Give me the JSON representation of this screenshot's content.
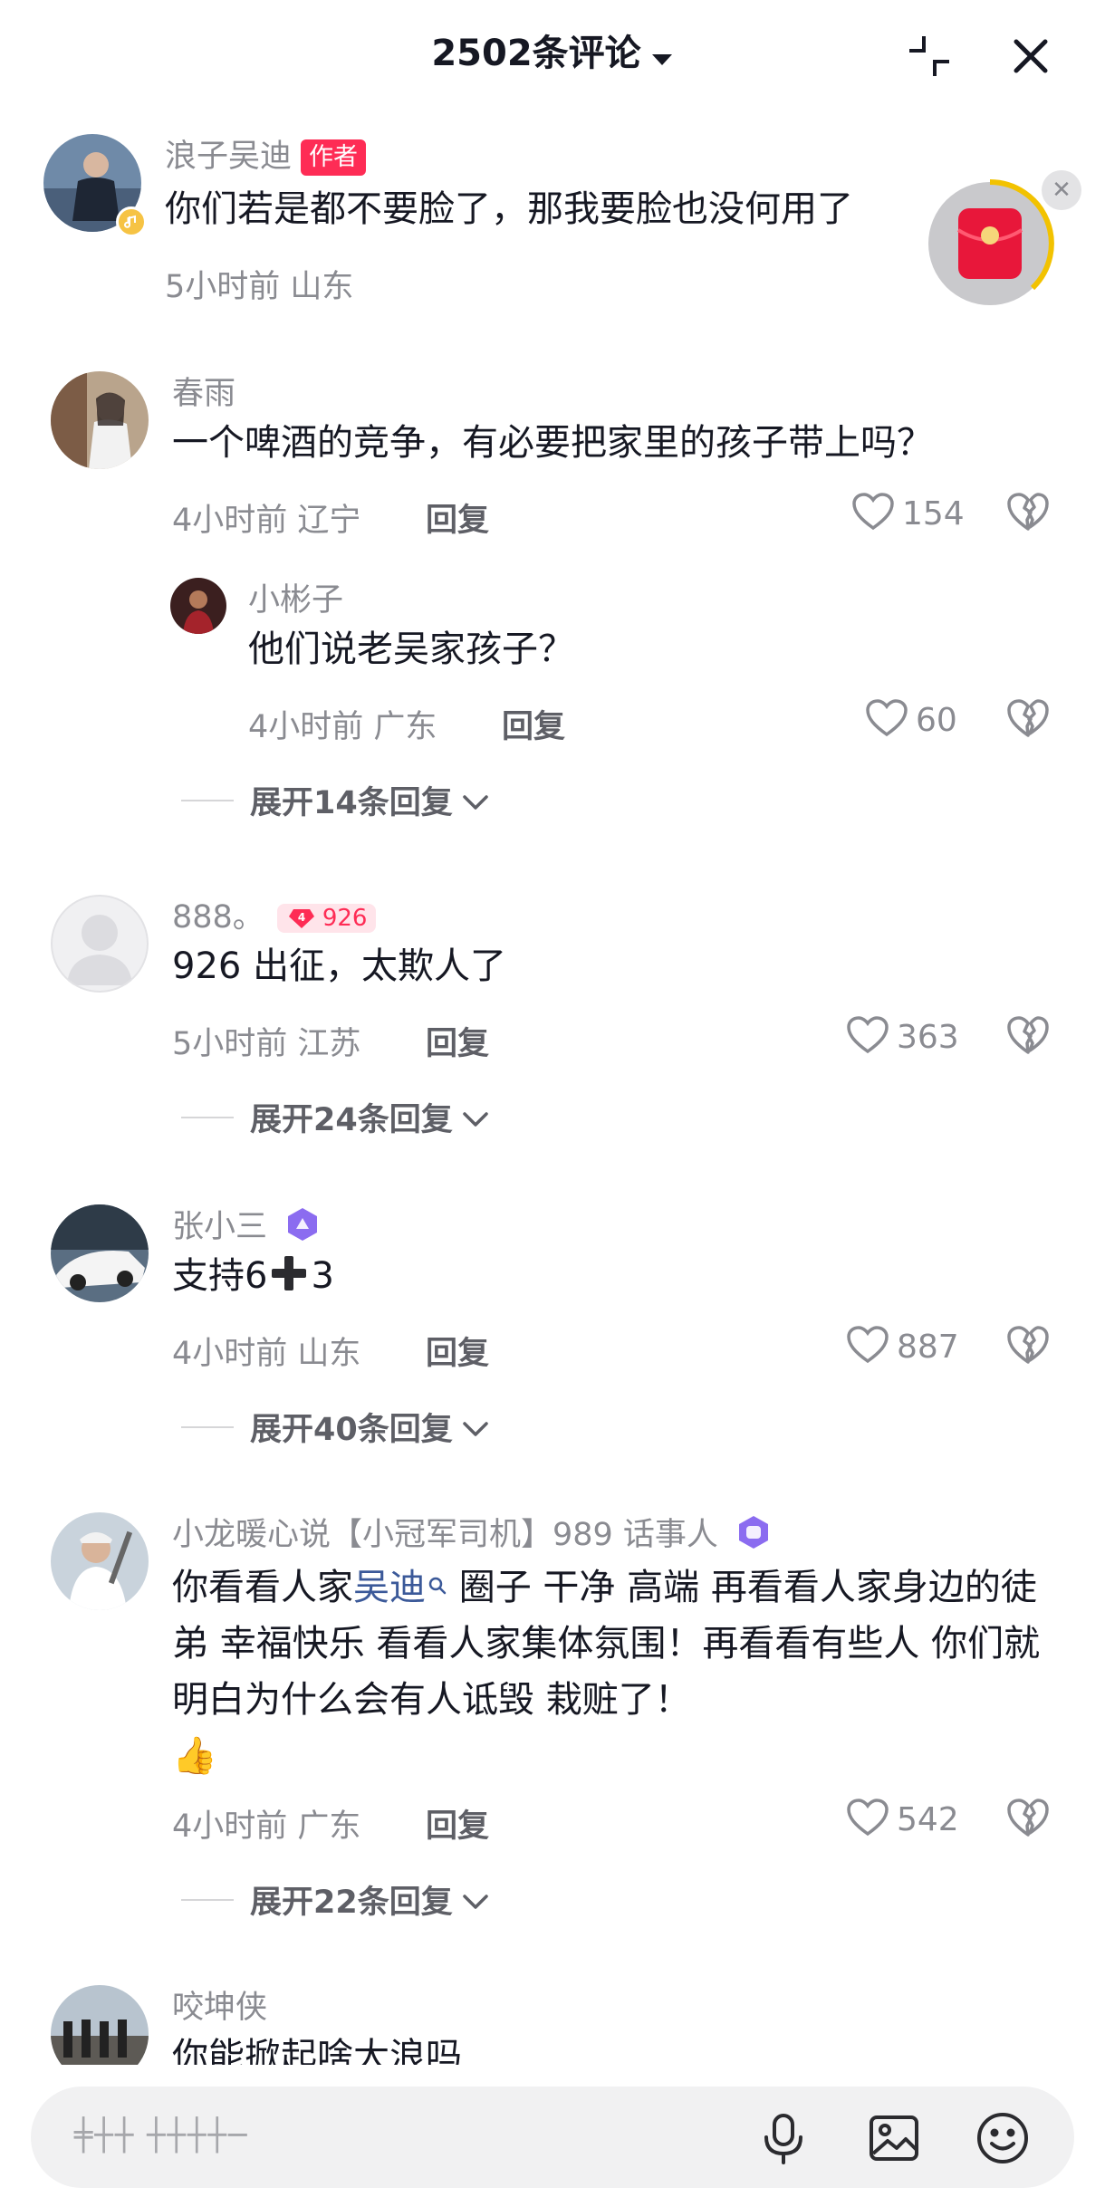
{
  "header": {
    "title": "2502条评论",
    "caret_icon": "caret-down-icon",
    "minimize_icon": "minimize-icon",
    "close_icon": "close-icon"
  },
  "floating": {
    "redpacket_icon": "red-packet-icon",
    "close_glyph": "✕"
  },
  "comments": [
    {
      "user": "浪子吴迪",
      "tag": "作者",
      "text": "你们若是都不要脸了，那我要脸也没何用了",
      "time": "5小时前",
      "location": "山东"
    },
    {
      "user": "春雨",
      "text": "一个啤酒的竞争，有必要把家里的孩子带上吗？",
      "time": "4小时前",
      "location": "辽宁",
      "reply_label": "回复",
      "likes": "154",
      "reply": {
        "user": "小彬子",
        "text": "他们说老吴家孩子？",
        "time": "4小时前",
        "location": "广东",
        "reply_label": "回复",
        "likes": "60"
      },
      "expand": "展开14条回复"
    },
    {
      "user": "888。",
      "badge_level": "4",
      "badge_text": "926",
      "text": "926 出征，太欺人了",
      "time": "5小时前",
      "location": "江苏",
      "reply_label": "回复",
      "likes": "363",
      "expand": "展开24条回复"
    },
    {
      "user": "张小三",
      "text_prefix": "支持6",
      "text_suffix": "3",
      "time": "4小时前",
      "location": "山东",
      "reply_label": "回复",
      "likes": "887",
      "expand": "展开40条回复"
    },
    {
      "user": "小龙暖心说【小冠军司机】989 话事人",
      "text_a": "你看看人家",
      "text_link": "吴迪",
      "text_b": " 圈子 干净 高端 再看看人家身边的徒弟 幸福快乐 看看人家集体氛围！再看看有些人 你们就明白为什么会有人诋毁 栽赃了！",
      "emoji": "👍",
      "time": "4小时前",
      "location": "广东",
      "reply_label": "回复",
      "likes": "542",
      "expand": "展开22条回复"
    },
    {
      "user": "咬坤侠",
      "text": "你能掀起啥大浪吗"
    }
  ],
  "input": {
    "placeholder": "╪┼┼ ┼┼┼┼─",
    "mic_icon": "microphone-icon",
    "image_icon": "image-icon",
    "emoji_icon": "emoji-icon"
  },
  "colors": {
    "accent": "#fe2c55",
    "text": "#161823",
    "muted": "#8a8b91",
    "link": "#3b5999"
  }
}
